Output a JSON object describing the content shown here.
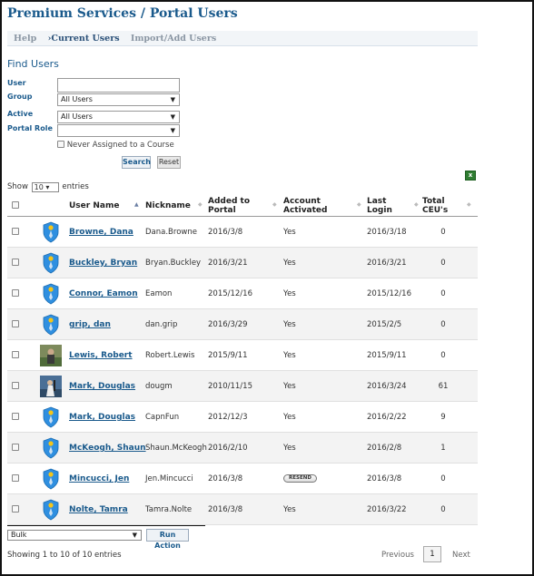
{
  "page_title": "Premium Services / Portal Users",
  "subnav": {
    "help": "Help",
    "current": "›Current Users",
    "import": "Import/Add Users"
  },
  "filters": {
    "heading": "Find Users",
    "user_label": "User",
    "user_value": "",
    "group_label": "Group",
    "group_value": "All Users",
    "active_label": "Active",
    "active_value": "All Users",
    "role_label": "Portal Role",
    "role_value": "",
    "never_assigned_label": "Never Assigned to a Course",
    "search_button": "Search",
    "reset_button": "Reset"
  },
  "length": {
    "prefix": "Show",
    "value": "10",
    "suffix": "entries"
  },
  "table": {
    "headers": {
      "user_name": "User Name",
      "nickname": "Nickname",
      "added_1": "Added to",
      "added_2": "Portal",
      "activated_1": "Account",
      "activated_2": "Activated",
      "login_1": "Last",
      "login_2": "Login",
      "ceu_1": "Total",
      "ceu_2": "CEU's"
    },
    "rows": [
      {
        "name": "Browne, Dana",
        "nickname": "Dana.Browne",
        "added": "2016/3/8",
        "activated": "Yes",
        "last_login": "2016/3/18",
        "ceus": "0",
        "avatar": "shield-icon"
      },
      {
        "name": "Buckley, Bryan",
        "nickname": "Bryan.Buckley",
        "added": "2016/3/21",
        "activated": "Yes",
        "last_login": "2016/3/21",
        "ceus": "0",
        "avatar": "shield-icon"
      },
      {
        "name": "Connor, Eamon",
        "nickname": "Eamon",
        "added": "2015/12/16",
        "activated": "Yes",
        "last_login": "2015/12/16",
        "ceus": "0",
        "avatar": "shield-icon"
      },
      {
        "name": "grip, dan",
        "nickname": "dan.grip",
        "added": "2016/3/29",
        "activated": "Yes",
        "last_login": "2015/2/5",
        "ceus": "0",
        "avatar": "shield-icon"
      },
      {
        "name": "Lewis, Robert",
        "nickname": "Robert.Lewis",
        "added": "2015/9/11",
        "activated": "Yes",
        "last_login": "2015/9/11",
        "ceus": "0",
        "avatar": "user-photo-lewis"
      },
      {
        "name": "Mark, Douglas",
        "nickname": "dougm",
        "added": "2010/11/15",
        "activated": "Yes",
        "last_login": "2016/3/24",
        "ceus": "61",
        "avatar": "user-photo-mark"
      },
      {
        "name": "Mark, Douglas",
        "nickname": "CapnFun",
        "added": "2012/12/3",
        "activated": "Yes",
        "last_login": "2016/2/22",
        "ceus": "9",
        "avatar": "shield-icon"
      },
      {
        "name": "McKeogh, Shaun",
        "nickname": "Shaun.McKeogh",
        "added": "2016/2/10",
        "activated": "Yes",
        "last_login": "2016/2/8",
        "ceus": "1",
        "avatar": "shield-icon"
      },
      {
        "name": "Mincucci, Jen",
        "nickname": "Jen.Mincucci",
        "added": "2016/3/8",
        "activated": "RESEND",
        "last_login": "2016/3/8",
        "ceus": "0",
        "avatar": "shield-icon"
      },
      {
        "name": "Nolte, Tamra",
        "nickname": "Tamra.Nolte",
        "added": "2016/3/8",
        "activated": "Yes",
        "last_login": "2016/3/22",
        "ceus": "0",
        "avatar": "shield-icon"
      }
    ]
  },
  "bulk": {
    "select_value": "Bulk",
    "run_button": "Run Action"
  },
  "footer": {
    "info": "Showing 1 to 10 of 10 entries",
    "previous": "Previous",
    "page": "1",
    "next": "Next"
  },
  "colors": {
    "brand": "#1a5a8c",
    "row_alt": "#f3f3f3",
    "shield": "#2f8fe0"
  }
}
